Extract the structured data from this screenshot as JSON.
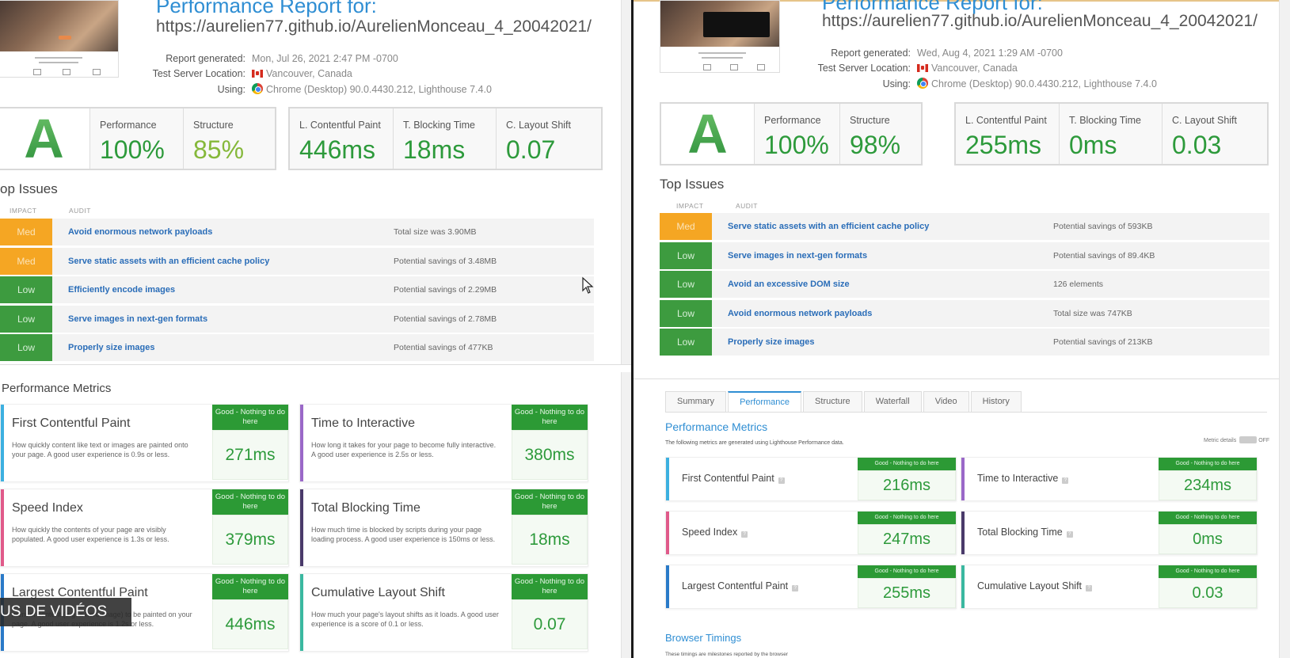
{
  "left": {
    "title": "Performance Report for:",
    "url": "https://aurelien77.github.io/AurelienMonceau_4_20042021/",
    "meta": {
      "generated_label": "Report generated:",
      "generated_value": "Mon, Jul 26, 2021 2:47 PM -0700",
      "location_label": "Test Server Location:",
      "location_value": "Vancouver, Canada",
      "using_label": "Using:",
      "using_value": "Chrome (Desktop) 90.0.4430.212, Lighthouse 7.4.0"
    },
    "grade": "A",
    "scores": [
      {
        "label": "Performance",
        "value": "100%"
      },
      {
        "label": "Structure",
        "value": "85%"
      }
    ],
    "vitals": [
      {
        "label": "L. Contentful Paint",
        "value": "446ms"
      },
      {
        "label": "T. Blocking Time",
        "value": "18ms"
      },
      {
        "label": "C. Layout Shift",
        "value": "0.07"
      }
    ],
    "issues_title": "op Issues",
    "col_impact": "IMPACT",
    "col_audit": "AUDIT",
    "issues": [
      {
        "impact": "Med",
        "audit": "Avoid enormous network payloads",
        "note": "Total size was 3.90MB"
      },
      {
        "impact": "Med",
        "audit": "Serve static assets with an efficient cache policy",
        "note": "Potential savings of 3.48MB"
      },
      {
        "impact": "Low",
        "audit": "Efficiently encode images",
        "note": "Potential savings of 2.29MB"
      },
      {
        "impact": "Low",
        "audit": "Serve images in next-gen formats",
        "note": "Potential savings of 2.78MB"
      },
      {
        "impact": "Low",
        "audit": "Properly size images",
        "note": "Potential savings of 477KB"
      }
    ],
    "pm_title": "Performance Metrics",
    "metrics": [
      {
        "name": "First Contentful Paint",
        "desc": "How quickly content like text or images are painted onto your page. A good user experience is 0.9s or less.",
        "badge": "Good - Nothing to do here",
        "value": "271ms"
      },
      {
        "name": "Time to Interactive",
        "desc": "How long it takes for your page to become fully interactive. A good user experience is 2.5s or less.",
        "badge": "Good - Nothing to do here",
        "value": "380ms"
      },
      {
        "name": "Speed Index",
        "desc": "How quickly the contents of your page are visibly populated. A good user experience is 1.3s or less.",
        "badge": "Good - Nothing to do here",
        "value": "379ms"
      },
      {
        "name": "Total Blocking Time",
        "desc": "How much time is blocked by scripts during your page loading process. A good user experience is 150ms or less.",
        "badge": "Good - Nothing to do here",
        "value": "18ms"
      },
      {
        "name": "Largest Contentful Paint",
        "desc": "ment of content (e.g. a hero image) to be painted on your page. A good user experience is 1.2s or less.",
        "badge": "Good - Nothing to do here",
        "value": "446ms"
      },
      {
        "name": "Cumulative Layout Shift",
        "desc": "How much your page's layout shifts as it loads. A good user experience is a score of 0.1 or less.",
        "badge": "Good - Nothing to do here",
        "value": "0.07"
      }
    ]
  },
  "right": {
    "title": "Performance Report for:",
    "url": "https://aurelien77.github.io/AurelienMonceau_4_20042021/",
    "meta": {
      "generated_label": "Report generated:",
      "generated_value": "Wed, Aug 4, 2021 1:29 AM -0700",
      "location_label": "Test Server Location:",
      "location_value": "Vancouver, Canada",
      "using_label": "Using:",
      "using_value": "Chrome (Desktop) 90.0.4430.212, Lighthouse 7.4.0"
    },
    "grade": "A",
    "scores": [
      {
        "label": "Performance",
        "value": "100%"
      },
      {
        "label": "Structure",
        "value": "98%"
      }
    ],
    "vitals": [
      {
        "label": "L. Contentful Paint",
        "value": "255ms"
      },
      {
        "label": "T. Blocking Time",
        "value": "0ms"
      },
      {
        "label": "C. Layout Shift",
        "value": "0.03"
      }
    ],
    "issues_title": "Top Issues",
    "col_impact": "IMPACT",
    "col_audit": "AUDIT",
    "issues": [
      {
        "impact": "Med",
        "audit": "Serve static assets with an efficient cache policy",
        "note": "Potential savings of 593KB"
      },
      {
        "impact": "Low",
        "audit": "Serve images in next-gen formats",
        "note": "Potential savings of 89.4KB"
      },
      {
        "impact": "Low",
        "audit": "Avoid an excessive DOM size",
        "note": "126 elements"
      },
      {
        "impact": "Low",
        "audit": "Avoid enormous network payloads",
        "note": "Total size was 747KB"
      },
      {
        "impact": "Low",
        "audit": "Properly size images",
        "note": "Potential savings of 213KB"
      }
    ],
    "tabs": [
      "Summary",
      "Performance",
      "Structure",
      "Waterfall",
      "Video",
      "History"
    ],
    "active_tab": "Performance",
    "pm_title": "Performance Metrics",
    "pm_sub": "The following metrics are generated using Lighthouse Performance data.",
    "toggle_label": "Metric details",
    "toggle_state": "OFF",
    "metrics": [
      {
        "name": "First Contentful Paint",
        "badge": "Good - Nothing to do here",
        "value": "216ms"
      },
      {
        "name": "Time to Interactive",
        "badge": "Good - Nothing to do here",
        "value": "234ms"
      },
      {
        "name": "Speed Index",
        "badge": "Good - Nothing to do here",
        "value": "247ms"
      },
      {
        "name": "Total Blocking Time",
        "badge": "Good - Nothing to do here",
        "value": "0ms"
      },
      {
        "name": "Largest Contentful Paint",
        "badge": "Good - Nothing to do here",
        "value": "255ms"
      },
      {
        "name": "Cumulative Layout Shift",
        "badge": "Good - Nothing to do here",
        "value": "0.03"
      }
    ],
    "browser_title": "Browser Timings",
    "browser_sub": "These timings are milestones reported by the browser"
  },
  "overlay_text": "US DE VIDÉOS",
  "colors": {
    "accent_blue": "#2f8ed3",
    "good_green": "#2d9a3b",
    "med_orange": "#f5a623",
    "low_green": "#3d9b3f",
    "bar_fcp": "#3cb0e0",
    "bar_tti": "#9a68c8",
    "bar_si": "#e05a8a",
    "bar_tbt": "#4a3a6a",
    "bar_lcp": "#2a7ac8",
    "bar_cls": "#3ab8a0"
  }
}
